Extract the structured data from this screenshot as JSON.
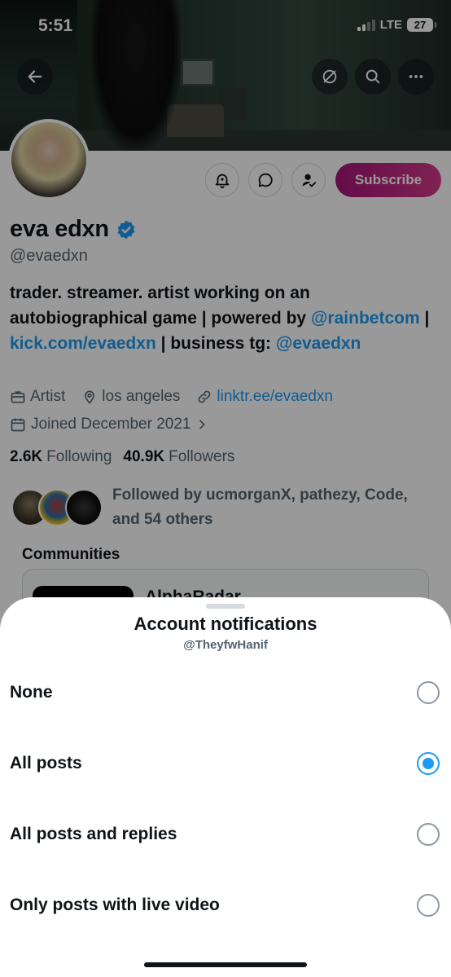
{
  "status_bar": {
    "time": "5:51",
    "network": "LTE",
    "battery": "27"
  },
  "nav": {
    "back": "arrow-left-icon",
    "hide": "eye-slash-icon",
    "search": "search-icon",
    "more": "more-icon"
  },
  "profile": {
    "display_name": "eva edxn",
    "handle": "@evaedxn",
    "bio": {
      "text1": "trader. streamer. artist working on an autobiographical game | powered by ",
      "link1": "@rainbetcom",
      "sep1": " | ",
      "link2": "kick.com/evaedxn",
      "text2": " | business tg: ",
      "link3": "@evaedxn"
    },
    "category": "Artist",
    "location": "los angeles",
    "website": "linktr.ee/evaedxn",
    "joined": "Joined December 2021",
    "following_count": "2.6K",
    "following_label": "Following",
    "followers_count": "40.9K",
    "followers_label": "Followers",
    "followed_by": "Followed by ucmorganX, pathezy, Code, and 54 others",
    "subscribe_label": "Subscribe",
    "communities_title": "Communities",
    "community_name": "AlphaRadar"
  },
  "sheet": {
    "title": "Account notifications",
    "subtitle": "@TheyfwHanif",
    "options": [
      {
        "label": "None",
        "selected": false
      },
      {
        "label": "All posts",
        "selected": true
      },
      {
        "label": "All posts and replies",
        "selected": false
      },
      {
        "label": "Only posts with live video",
        "selected": false
      }
    ]
  },
  "colors": {
    "accent": "#1d9bf0",
    "subscribe_start": "#a6157a",
    "subscribe_end": "#d63a8a",
    "text": "#0f1419",
    "muted": "#536471"
  }
}
